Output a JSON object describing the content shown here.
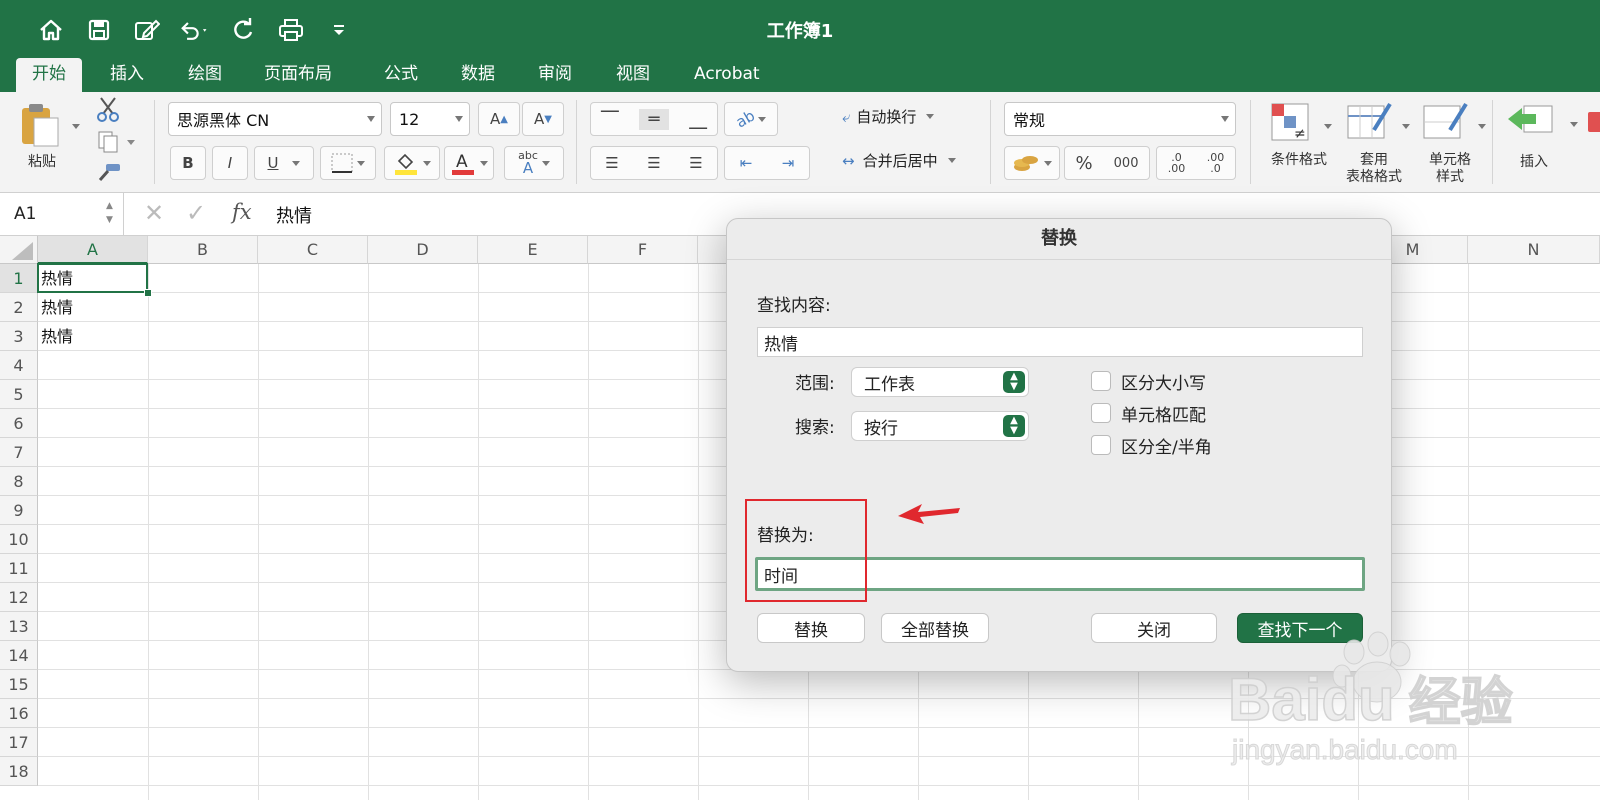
{
  "window": {
    "title": "工作簿1"
  },
  "tabs": [
    "开始",
    "插入",
    "绘图",
    "页面布局",
    "公式",
    "数据",
    "审阅",
    "视图",
    "Acrobat"
  ],
  "ribbon": {
    "paste_label": "粘贴",
    "font_name": "思源黑体 CN",
    "font_size": "12",
    "bold": "B",
    "italic": "I",
    "underline": "U",
    "wrap_text": "自动换行",
    "merge_center": "合并后居中",
    "number_format": "常规",
    "percent": "%",
    "thousands": "000",
    "conditional_format": "条件格式",
    "table_format_line1": "套用",
    "table_format_line2": "表格格式",
    "cell_style_line1": "单元格",
    "cell_style_line2": "样式",
    "insert_label": "插入",
    "abc": "abc",
    "dec_more": ".0",
    "dec_more2": ".00",
    "dec_less": ".00",
    "dec_less2": ".0"
  },
  "formula_bar": {
    "name_box": "A1",
    "fx": "fx",
    "content": "热情"
  },
  "grid": {
    "columns": [
      "A",
      "B",
      "C",
      "D",
      "E",
      "F",
      "M",
      "N"
    ],
    "rows": [
      "1",
      "2",
      "3",
      "4",
      "5",
      "6",
      "7",
      "8",
      "9",
      "10",
      "11",
      "12",
      "13",
      "14",
      "15",
      "16",
      "17",
      "18"
    ],
    "cells": [
      "热情",
      "热情",
      "热情"
    ]
  },
  "dialog": {
    "title": "替换",
    "find_label": "查找内容:",
    "find_value": "热情",
    "scope_label": "范围:",
    "scope_value": "工作表",
    "search_label": "搜索:",
    "search_value": "按行",
    "opt_case": "区分大小写",
    "opt_cell": "单元格匹配",
    "opt_width": "区分全/半角",
    "replace_label": "替换为:",
    "replace_value": "时间",
    "btn_replace": "替换",
    "btn_replace_all": "全部替换",
    "btn_close": "关闭",
    "btn_find_next": "查找下一个"
  },
  "watermark": {
    "brand": "Baidu",
    "cn": "经验",
    "url": "jingyan.baidu.com"
  },
  "colors": {
    "accent": "#217346",
    "annotation": "#e0282e"
  }
}
